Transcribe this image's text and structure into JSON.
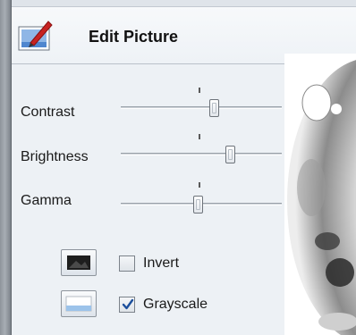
{
  "header": {
    "title": "Edit Picture",
    "icon": "edit-picture-icon"
  },
  "adjustments": [
    {
      "label": "Contrast",
      "value": 0.59
    },
    {
      "label": "Brightness",
      "value": 0.68
    },
    {
      "label": "Gamma",
      "value": 0.48
    }
  ],
  "options": {
    "invert": {
      "label": "Invert",
      "checked": false,
      "icon": "invert-icon"
    },
    "grayscale": {
      "label": "Grayscale",
      "checked": true,
      "icon": "grayscale-icon"
    }
  },
  "preview": {
    "icon": "picture-preview"
  },
  "colors": {
    "accent_check": "#1b4f9c",
    "header_bg": "#f4f7fa",
    "panel_bg": "#edf1f5"
  }
}
